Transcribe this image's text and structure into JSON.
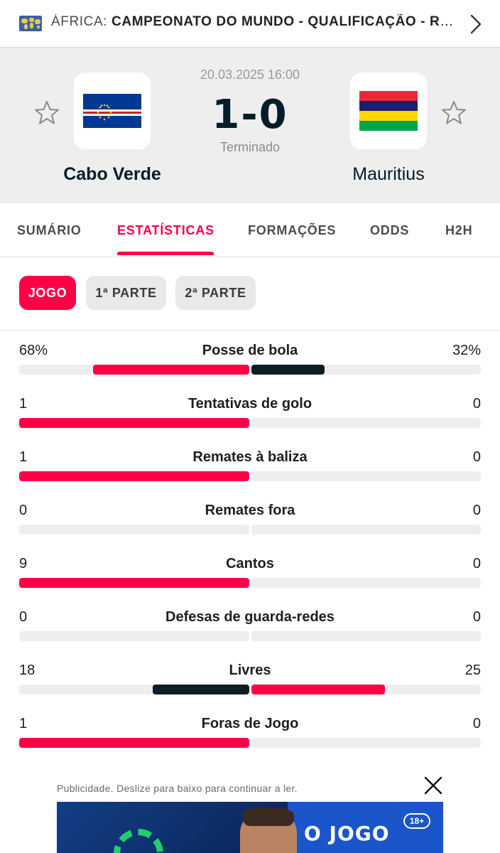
{
  "league": {
    "region": "ÁFRICA:",
    "competition": "CAMPEONATO DO MUNDO - QUALIFICAÇÃO - RON...",
    "flag_icon": "world-map-icon"
  },
  "match": {
    "date_time": "20.03.2025 16:00",
    "score": "1-0",
    "status": "Terminado",
    "home": {
      "name": "Cabo Verde",
      "flag_colors": [
        "#003893",
        "#ffffff",
        "#cf2027",
        "#f7d116"
      ]
    },
    "away": {
      "name": "Mauritius",
      "flag_colors": [
        "#ea2839",
        "#1a206d",
        "#ffd500",
        "#00a551"
      ]
    }
  },
  "tabs": [
    {
      "label": "SUMÁRIO"
    },
    {
      "label": "ESTATÍSTICAS",
      "active": true
    },
    {
      "label": "FORMAÇÕES"
    },
    {
      "label": "ODDS"
    },
    {
      "label": "H2H"
    }
  ],
  "periods": [
    {
      "label": "JOGO",
      "active": true
    },
    {
      "label": "1ª PARTE"
    },
    {
      "label": "2ª PARTE"
    }
  ],
  "colors": {
    "accent": "#ff0046",
    "dark_bar": "#0f1e26",
    "track": "#eeeeee"
  },
  "stats": [
    {
      "label": "Posse de bola",
      "home": "68%",
      "away": "32%",
      "home_value": 68,
      "away_value": 32,
      "home_winner": true
    },
    {
      "label": "Tentativas de golo",
      "home": "1",
      "away": "0",
      "home_value": 1,
      "away_value": 0,
      "home_winner": true
    },
    {
      "label": "Remates à baliza",
      "home": "1",
      "away": "0",
      "home_value": 1,
      "away_value": 0,
      "home_winner": true
    },
    {
      "label": "Remates fora",
      "home": "0",
      "away": "0",
      "home_value": 0,
      "away_value": 0
    },
    {
      "label": "Cantos",
      "home": "9",
      "away": "0",
      "home_value": 9,
      "away_value": 0,
      "home_winner": true
    },
    {
      "label": "Defesas de guarda-redes",
      "home": "0",
      "away": "0",
      "home_value": 0,
      "away_value": 0
    },
    {
      "label": "Livres",
      "home": "18",
      "away": "25",
      "home_value": 18,
      "away_value": 25,
      "away_winner": true
    },
    {
      "label": "Foras de Jogo",
      "home": "1",
      "away": "0",
      "home_value": 1,
      "away_value": 0,
      "home_winner": true
    }
  ],
  "ad": {
    "caption": "Publicidade. Deslize para baixo para continuar a ler.",
    "headline": "O JOGO",
    "age_badge": "18+"
  }
}
